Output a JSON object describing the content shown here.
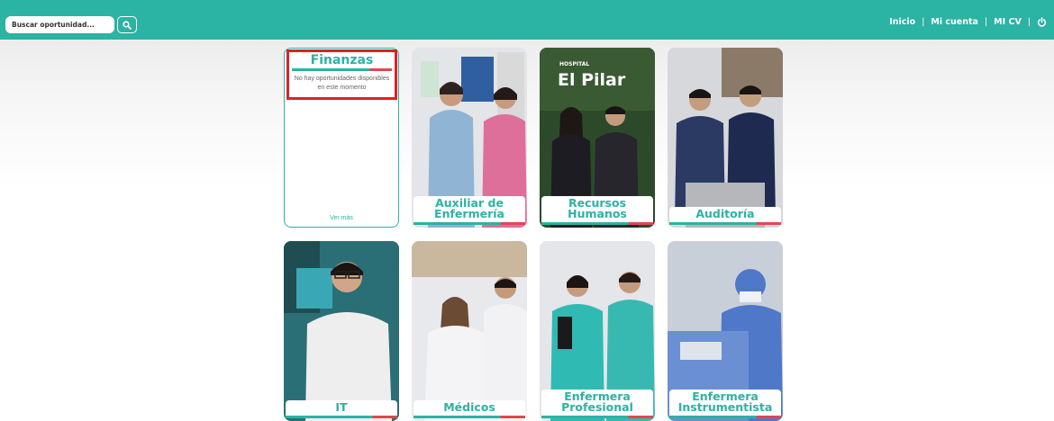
{
  "search": {
    "placeholder": "Buscar oportunidad..."
  },
  "nav": {
    "inicio": "Inicio",
    "mi_cuenta": "Mi cuenta",
    "mi_cv": "MI CV",
    "separator": "|"
  },
  "finanzas": {
    "title": "Finanzas",
    "message": "No hay oportunidades disponibles en este momento",
    "more": "Ver más"
  },
  "cards": [
    {
      "label": "Auxiliar de Enfermería"
    },
    {
      "label": "Recursos Humanos",
      "sign": "El Pilar",
      "sign_small": "HOSPITAL"
    },
    {
      "label": "Auditoría"
    },
    {
      "label": "IT"
    },
    {
      "label": "Médicos"
    },
    {
      "label": "Enfermera Profesional"
    },
    {
      "label": "Enfermera Instrumentista"
    }
  ],
  "colors": {
    "brand": "#2bb3a3",
    "accent_red": "#e2474f",
    "highlight": "#e01f26"
  }
}
